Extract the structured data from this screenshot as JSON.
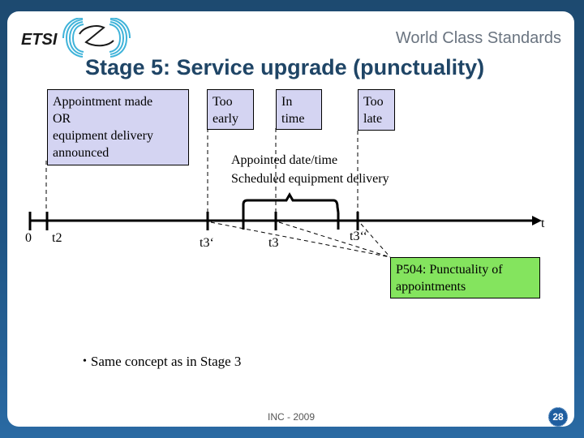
{
  "header": {
    "logo_text": "ETSI",
    "tagline": "World Class Standards",
    "title": "Stage 5: Service upgrade (punctuality)"
  },
  "boxes": {
    "appointment": [
      "Appointment made",
      "OR",
      "equipment delivery",
      "announced"
    ],
    "too_early": [
      "Too",
      "early"
    ],
    "in_time": [
      "In",
      "time"
    ],
    "too_late": [
      "Too",
      "late"
    ]
  },
  "scheduled_label": [
    "Appointed date/time",
    "Scheduled equipment delivery"
  ],
  "timeline": {
    "ticks": [
      {
        "label": "0"
      },
      {
        "label": "t2"
      },
      {
        "label": "t3‘"
      },
      {
        "label": "t3"
      },
      {
        "label": "t3‘‘"
      }
    ],
    "axis_label": "t"
  },
  "metric_box": [
    "P504: Punctuality of",
    "appointments"
  ],
  "bullet": {
    "symbol": "•",
    "text": "Same concept as in Stage 3"
  },
  "footer": {
    "text": "INC - 2009",
    "page_number": "28"
  },
  "colors": {
    "frame": "#1d4a70",
    "title": "#1f4566",
    "box_fill": "#d4d4f2",
    "metric_fill": "#84e45e",
    "logo_wave": "#3fb3d9"
  }
}
